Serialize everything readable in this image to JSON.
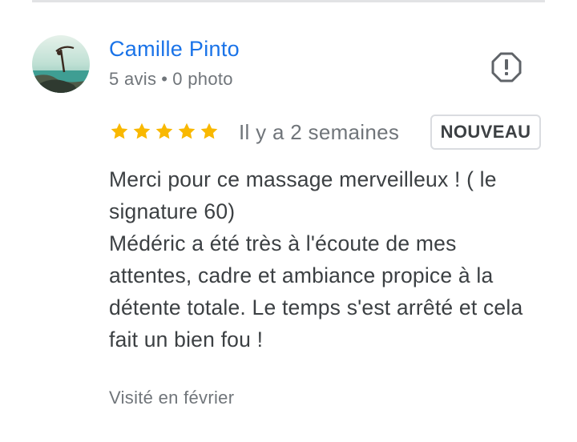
{
  "reviewer": {
    "name": "Camille Pinto",
    "reviews_count": "5 avis",
    "separator": "•",
    "photos_count": "0 photo"
  },
  "rating": {
    "stars": 5,
    "max": 5,
    "color": "#f9b800"
  },
  "date": "Il y a 2 semaines",
  "badge": "NOUVEAU",
  "review": {
    "paragraph1": "Merci pour ce massage merveilleux ! ( le signature 60)",
    "paragraph2": "Médéric a été très à l'écoute de mes attentes, cadre et ambiance propice à la détente totale. Le temps s'est arrêté et cela fait un bien fou !"
  },
  "visited": "Visité en février",
  "icons": {
    "report": "report-icon",
    "star": "star-icon"
  },
  "colors": {
    "name_link": "#1a73e8",
    "muted": "#70757a",
    "text": "#3c4043"
  }
}
